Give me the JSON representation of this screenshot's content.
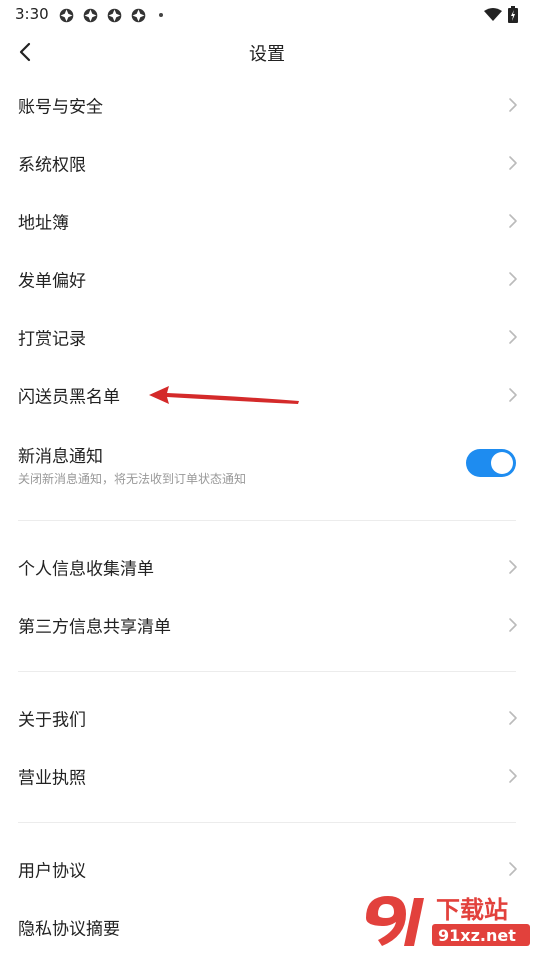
{
  "status_bar": {
    "time": "3:30"
  },
  "header": {
    "title": "设置"
  },
  "group1": [
    {
      "label": "账号与安全"
    },
    {
      "label": "系统权限"
    },
    {
      "label": "地址簿"
    },
    {
      "label": "发单偏好"
    },
    {
      "label": "打赏记录"
    },
    {
      "label": "闪送员黑名单"
    }
  ],
  "notification": {
    "title": "新消息通知",
    "subtitle": "关闭新消息通知，将无法收到订单状态通知",
    "enabled": true
  },
  "group2": [
    {
      "label": "个人信息收集清单"
    },
    {
      "label": "第三方信息共享清单"
    }
  ],
  "group3": [
    {
      "label": "关于我们"
    },
    {
      "label": "营业执照"
    }
  ],
  "group4": [
    {
      "label": "用户协议"
    },
    {
      "label": "隐私协议摘要"
    }
  ],
  "watermark": {
    "brand": "下载站",
    "domain": "91xz.net"
  },
  "colors": {
    "toggle_on": "#1e8cf0",
    "annotation_arrow": "#d42a2a",
    "watermark_red": "#e0312c"
  }
}
